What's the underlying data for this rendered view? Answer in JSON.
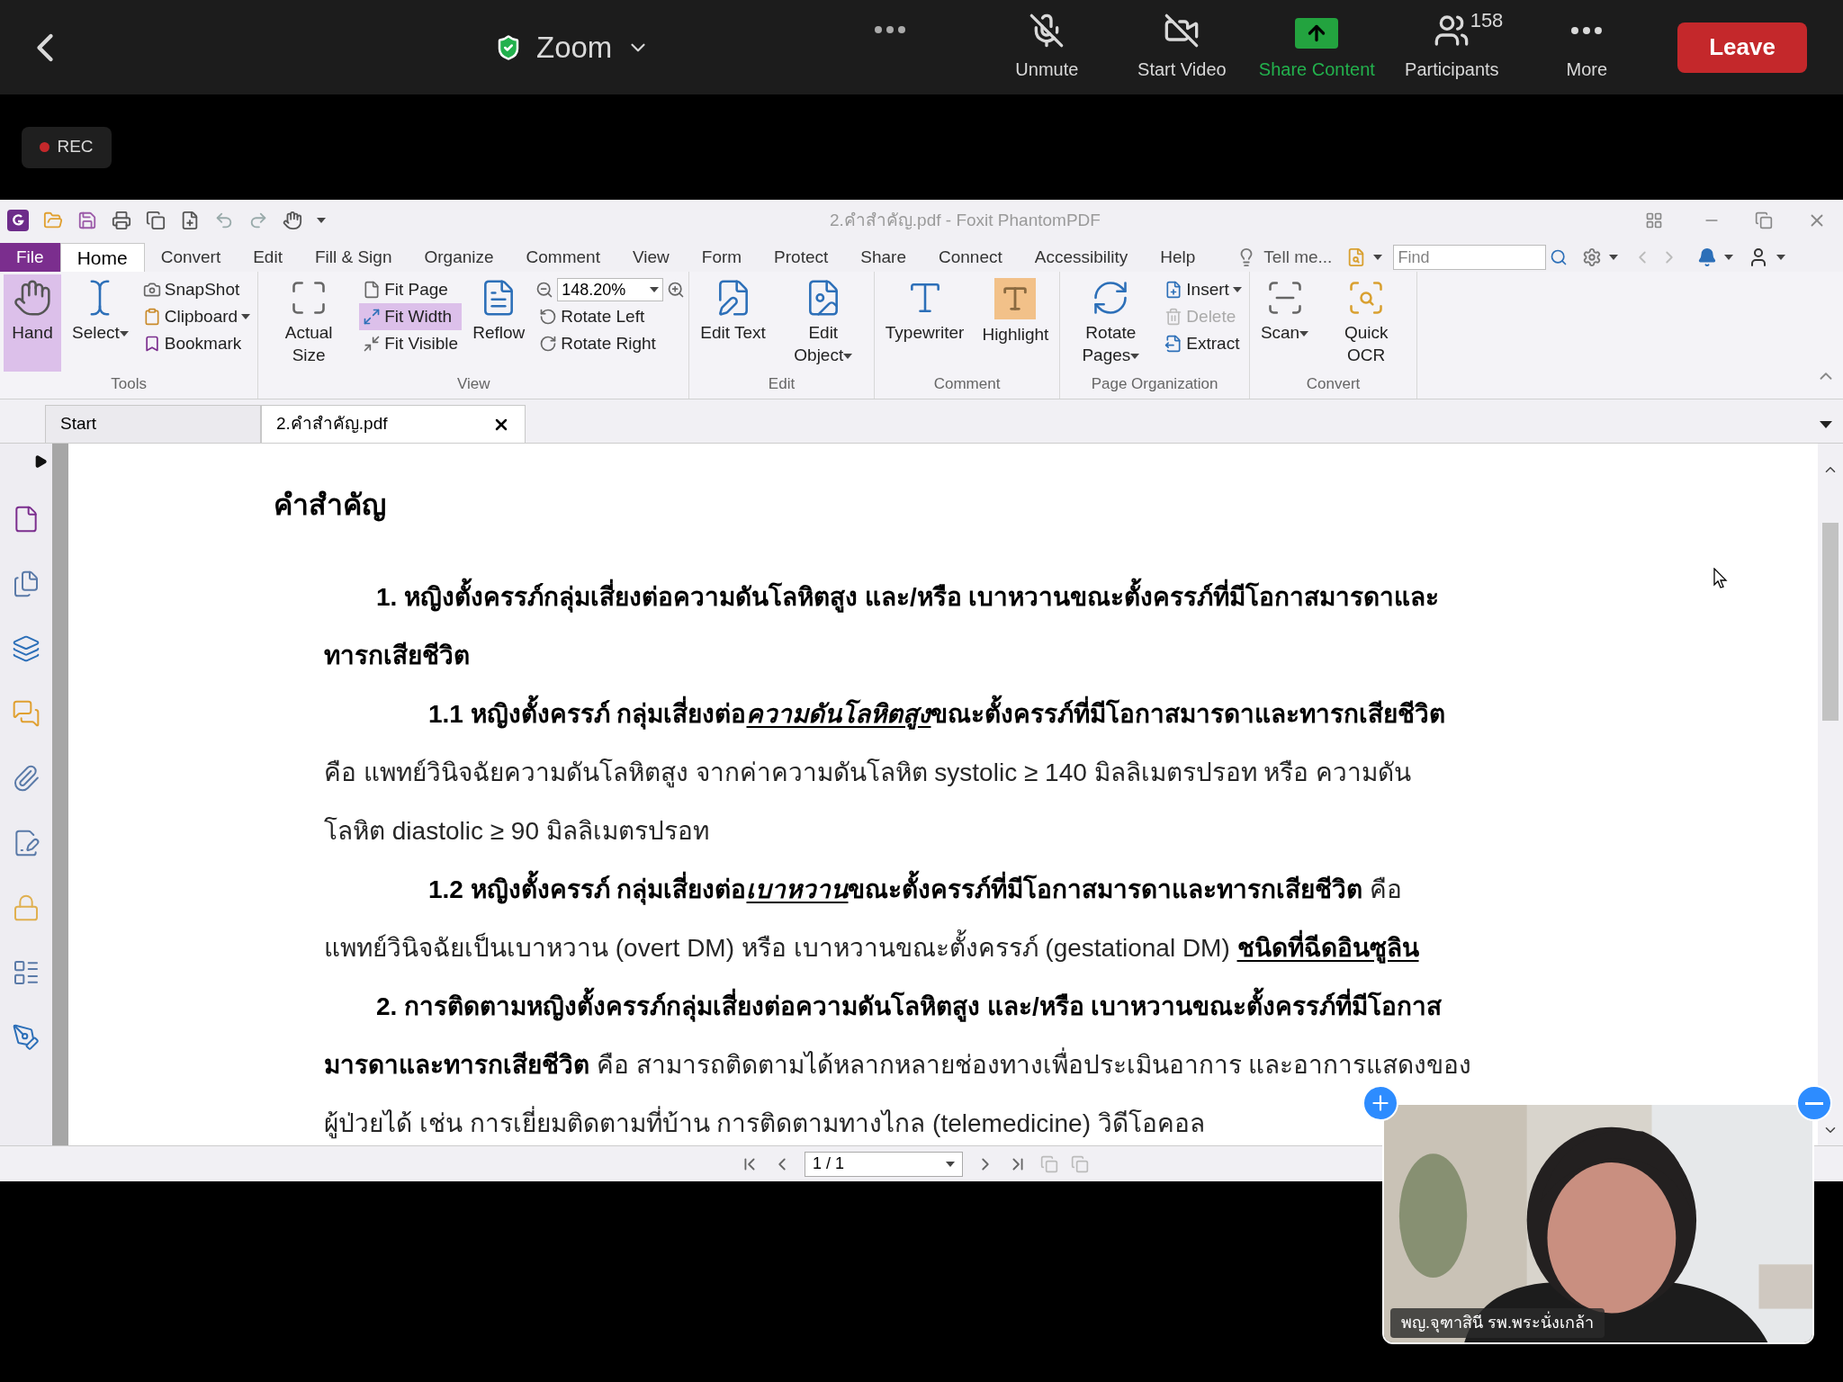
{
  "meeting_bar": {
    "title": "Zoom",
    "controls": [
      {
        "label": "Unmute",
        "kind": "mic"
      },
      {
        "label": "Start Video",
        "kind": "video"
      },
      {
        "label": "Share Content",
        "kind": "share"
      },
      {
        "label": "Participants",
        "kind": "participants",
        "count": "158"
      },
      {
        "label": "More",
        "kind": "more"
      }
    ],
    "leave": "Leave"
  },
  "recording": {
    "label": "REC"
  },
  "window": {
    "title": "2.คำสำคัญ.pdf - Foxit PhantomPDF"
  },
  "menu_tabs": [
    {
      "label": "File",
      "kind": "file",
      "selected": false
    },
    {
      "label": "Home",
      "kind": "tab",
      "selected": true
    },
    {
      "label": "Convert",
      "kind": "tab",
      "selected": false
    },
    {
      "label": "Edit",
      "kind": "tab",
      "selected": false
    },
    {
      "label": "Fill & Sign",
      "kind": "tab",
      "selected": false
    },
    {
      "label": "Organize",
      "kind": "tab",
      "selected": false
    },
    {
      "label": "Comment",
      "kind": "tab",
      "selected": false
    },
    {
      "label": "View",
      "kind": "tab",
      "selected": false
    },
    {
      "label": "Form",
      "kind": "tab",
      "selected": false
    },
    {
      "label": "Protect",
      "kind": "tab",
      "selected": false
    },
    {
      "label": "Share",
      "kind": "tab",
      "selected": false
    },
    {
      "label": "Connect",
      "kind": "tab",
      "selected": false
    },
    {
      "label": "Accessibility",
      "kind": "tab",
      "selected": false
    },
    {
      "label": "Help",
      "kind": "tab",
      "selected": false
    }
  ],
  "tell_me": "Tell me...",
  "find": {
    "placeholder": "Find"
  },
  "ribbon_groups": [
    {
      "label": "Tools",
      "items": [
        {
          "kind": "large",
          "label": "Hand",
          "selected": true
        },
        {
          "kind": "large",
          "label": "Select",
          "selected": false,
          "dropdown": true
        },
        {
          "kind": "stack",
          "items": [
            {
              "label": "SnapShot",
              "selected": false
            },
            {
              "label": "Clipboard",
              "selected": false,
              "dropdown": true
            },
            {
              "label": "Bookmark",
              "selected": false
            }
          ]
        }
      ]
    },
    {
      "label": "View",
      "items": [
        {
          "kind": "large",
          "label": "Actual Size",
          "selected": false
        },
        {
          "kind": "stack",
          "items": [
            {
              "label": "Fit Page",
              "selected": false
            },
            {
              "label": "Fit Width",
              "selected": true
            },
            {
              "label": "Fit Visible",
              "selected": false
            }
          ]
        },
        {
          "kind": "large",
          "label": "Reflow",
          "selected": false
        },
        {
          "kind": "zoomstack",
          "zoom": "148.20%",
          "items": [
            {
              "label": "Rotate Left",
              "selected": false
            },
            {
              "label": "Rotate Right",
              "selected": false
            }
          ]
        }
      ]
    },
    {
      "label": "Edit",
      "items": [
        {
          "kind": "large",
          "label": "Edit Text",
          "selected": false
        },
        {
          "kind": "large",
          "label": "Edit Object",
          "selected": false,
          "dropdown": true
        }
      ]
    },
    {
      "label": "Comment",
      "items": [
        {
          "kind": "large",
          "label": "Typewriter",
          "selected": false
        },
        {
          "kind": "large",
          "label": "Highlight",
          "selected": false
        }
      ]
    },
    {
      "label": "Page Organization",
      "items": [
        {
          "kind": "large",
          "label": "Rotate Pages",
          "selected": false,
          "dropdown": true
        },
        {
          "kind": "stack",
          "items": [
            {
              "label": "Insert",
              "selected": false,
              "dropdown": true,
              "disabled": false
            },
            {
              "label": "Delete",
              "selected": false,
              "disabled": true
            },
            {
              "label": "Extract",
              "selected": false,
              "disabled": false
            }
          ]
        }
      ]
    },
    {
      "label": "Convert",
      "items": [
        {
          "kind": "large",
          "label": "Scan",
          "selected": false,
          "dropdown": true
        },
        {
          "kind": "large",
          "label": "Quick OCR",
          "selected": false
        }
      ]
    }
  ],
  "doc_tabs": [
    {
      "label": "Start",
      "selected": false,
      "closable": false
    },
    {
      "label": "2.คำสำคัญ.pdf",
      "selected": true,
      "closable": true
    }
  ],
  "document": {
    "lines": [
      {
        "kind": "heading",
        "runs": [
          {
            "text": "คำสำคัญ",
            "bold": true
          }
        ]
      },
      {
        "kind": "item",
        "runs": [
          {
            "text": "1. หญิงตั้งครรภ์กลุ่มเสี่ยงต่อความดันโลหิตสูง และ/หรือ เบาหวานขณะตั้งครรภ์ที่มีโอกาสมารดาและ",
            "bold": true
          }
        ]
      },
      {
        "kind": "cont",
        "runs": [
          {
            "text": "ทารกเสียชีวิต",
            "bold": true
          }
        ]
      },
      {
        "kind": "subitem",
        "runs": [
          {
            "text": "1.1 หญิงตั้งครรภ์ กลุ่มเสี่ยงต่อ",
            "bold": true
          },
          {
            "text": "ความดันโลหิตสูง",
            "bold": true,
            "italic": true,
            "underline": true
          },
          {
            "text": "ขณะตั้งครรภ์ที่มีโอกาสมารดาและทารกเสียชีวิต",
            "bold": true
          }
        ]
      },
      {
        "kind": "cont",
        "runs": [
          {
            "text": "คือ แพทย์วินิจฉัยความดันโลหิตสูง จากค่าความดันโลหิต systolic ≥ 140 มิลลิเมตรปรอท หรือ ความดัน"
          }
        ]
      },
      {
        "kind": "cont",
        "runs": [
          {
            "text": "โลหิต diastolic ≥ 90 มิลลิเมตรปรอท"
          }
        ]
      },
      {
        "kind": "subitem",
        "runs": [
          {
            "text": "1.2 หญิงตั้งครรภ์ กลุ่มเสี่ยงต่อ",
            "bold": true
          },
          {
            "text": "เบาหวาน",
            "bold": true,
            "italic": true,
            "underline": true
          },
          {
            "text": "ขณะตั้งครรภ์ที่มีโอกาสมารดาและทารกเสียชีวิต",
            "bold": true
          },
          {
            "text": " คือ"
          }
        ]
      },
      {
        "kind": "cont",
        "runs": [
          {
            "text": "แพทย์วินิจฉัยเป็นเบาหวาน (overt DM) หรือ เบาหวานขณะตั้งครรภ์ (gestational DM) "
          },
          {
            "text": "ชนิดที่ฉีดอินซูลิน",
            "bold": true,
            "underline": true
          }
        ]
      },
      {
        "kind": "item",
        "runs": [
          {
            "text": "2. การติดตามหญิงตั้งครรภ์กลุ่มเสี่ยงต่อความดันโลหิตสูง และ/หรือ เบาหวานขณะตั้งครรภ์ที่มีโอกาส",
            "bold": true
          }
        ]
      },
      {
        "kind": "cont",
        "runs": [
          {
            "text": "มารดาและทารกเสียชีวิต",
            "bold": true
          },
          {
            "text": " คือ สามารถติดตามได้หลากหลายช่องทางเพื่อประเมินอาการ และอาการแสดงของ"
          }
        ]
      },
      {
        "kind": "cont",
        "runs": [
          {
            "text": "ผู้ป่วยได้ เช่น การเยี่ยมติดตามที่บ้าน การติดตามทางไกล (telemedicine) วิดีโอคอล"
          }
        ]
      }
    ]
  },
  "status_bar": {
    "page": "1 / 1"
  },
  "video_tile": {
    "kind": "picture",
    "name": "พญ.จุฑาสินี รพ.พระนั่งเกล้า"
  }
}
